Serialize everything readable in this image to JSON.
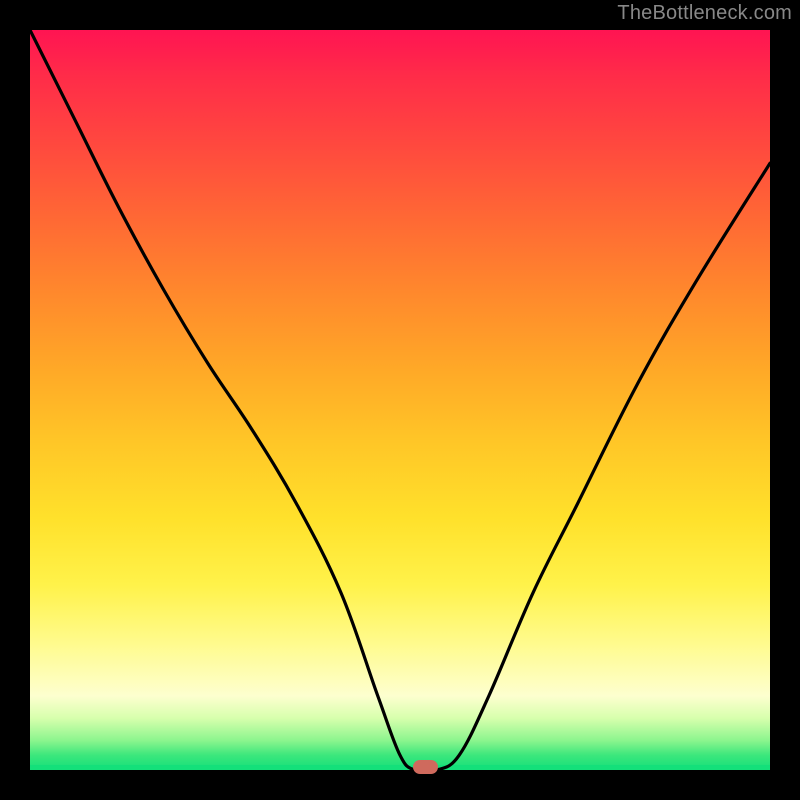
{
  "watermark": "TheBottleneck.com",
  "colors": {
    "background": "#000000",
    "curve": "#000000",
    "marker": "#cf6a5d",
    "watermark_text": "#888888"
  },
  "chart_data": {
    "type": "line",
    "title": "",
    "xlabel": "",
    "ylabel": "",
    "xlim": [
      0,
      100
    ],
    "ylim": [
      0,
      100
    ],
    "grid": false,
    "legend": false,
    "series": [
      {
        "name": "curve",
        "x": [
          0,
          6,
          12,
          18,
          24,
          30,
          36,
          42,
          47,
          50,
          52,
          55,
          58,
          62,
          68,
          74,
          82,
          90,
          100
        ],
        "y": [
          100,
          88,
          76,
          65,
          55,
          46,
          36,
          24,
          10,
          2,
          0,
          0,
          2,
          10,
          24,
          36,
          52,
          66,
          82
        ]
      }
    ],
    "annotations": [
      {
        "name": "marker",
        "x": 53.5,
        "y": 0
      }
    ],
    "gradient_stops": [
      {
        "pos": 0.0,
        "color": "#ff1452"
      },
      {
        "pos": 0.5,
        "color": "#ffc727"
      },
      {
        "pos": 0.9,
        "color": "#fdffcf"
      },
      {
        "pos": 1.0,
        "color": "#14e07a"
      }
    ]
  }
}
